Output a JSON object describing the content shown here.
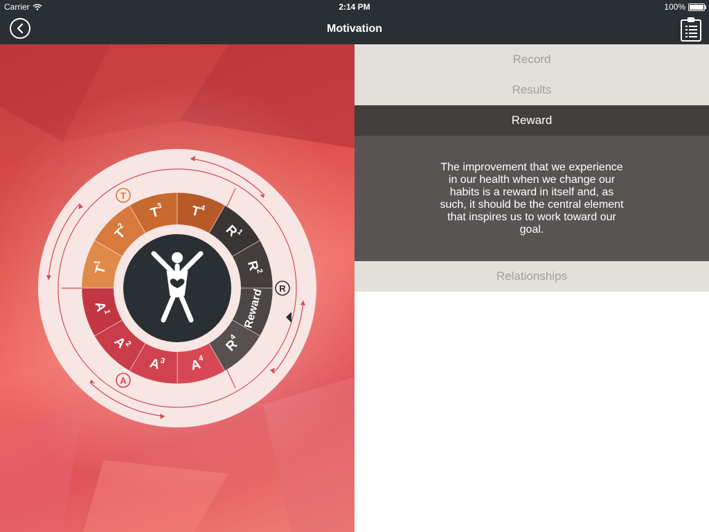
{
  "status_bar": {
    "carrier": "Carrier",
    "time": "2:14 PM",
    "battery": "100%",
    "battery_level": 1.0
  },
  "nav": {
    "title": "Motivation",
    "back_icon": "chevron-left-icon",
    "action_icon": "clipboard-list-icon"
  },
  "wheel": {
    "outer_markers": {
      "t": "T",
      "r": "R",
      "a": "A"
    },
    "segments": {
      "t1": {
        "letter": "T",
        "sup": "1"
      },
      "t2": {
        "letter": "T",
        "sup": "2"
      },
      "t3": {
        "letter": "T",
        "sup": "3"
      },
      "t4": {
        "letter": "T",
        "sup": "4"
      },
      "r1": {
        "letter": "R",
        "sup": "1"
      },
      "r2": {
        "letter": "R",
        "sup": "2"
      },
      "reward": "Reward",
      "r4": {
        "letter": "R",
        "sup": "4"
      },
      "a1": {
        "letter": "A",
        "sup": "1"
      },
      "a2": {
        "letter": "A",
        "sup": "2"
      },
      "a3": {
        "letter": "A",
        "sup": "3"
      },
      "a4": {
        "letter": "A",
        "sup": "4"
      }
    },
    "center_icon": "person-heart-icon",
    "colors": {
      "t": "#d87a3e",
      "r": "#3f3a39",
      "a": "#d94050",
      "center": "#2a2f34"
    }
  },
  "accordion": {
    "items": [
      {
        "label": "Record"
      },
      {
        "label": "Results"
      },
      {
        "label": "Reward",
        "description": "The improvement that we experience in our health when we change our habits is a reward in itself and, as such, it should be the central element that inspires us to work toward our goal."
      },
      {
        "label": "Relationships"
      }
    ]
  }
}
